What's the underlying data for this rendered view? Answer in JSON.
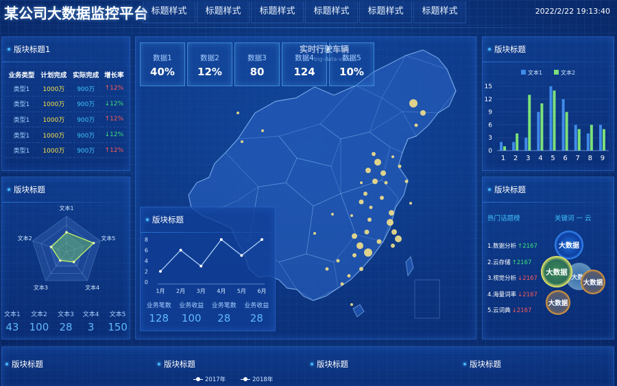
{
  "header": {
    "title": "某公司大数据监控平台",
    "tabs": [
      "标题样式",
      "标题样式",
      "标题样式",
      "标题样式",
      "标题样式",
      "标题样式"
    ],
    "datetime": "2022/2/22 19:13:40"
  },
  "panel_table": {
    "title": "版块标题1",
    "columns": [
      "业务类型",
      "计划完成",
      "实际完成",
      "增长率"
    ],
    "rows": [
      {
        "type": "类型1",
        "plan": "1000万",
        "done": "900万",
        "growth": "↑12%",
        "dir": "up"
      },
      {
        "type": "类型1",
        "plan": "1000万",
        "done": "900万",
        "growth": "↓12%",
        "dir": "down"
      },
      {
        "type": "类型1",
        "plan": "1000万",
        "done": "900万",
        "growth": "↑12%",
        "dir": "up"
      },
      {
        "type": "类型1",
        "plan": "1000万",
        "done": "900万",
        "growth": "↓12%",
        "dir": "down"
      },
      {
        "type": "类型1",
        "plan": "1000万",
        "done": "900万",
        "growth": "↑12%",
        "dir": "up"
      }
    ]
  },
  "panel_radar": {
    "title": "版块标题",
    "axis_labels": [
      "文本1",
      "文本5",
      "文本4",
      "文本3",
      "文本2"
    ],
    "stats": [
      {
        "label": "文本1",
        "value": "43"
      },
      {
        "label": "文本2",
        "value": "100"
      },
      {
        "label": "文本3",
        "value": "28"
      },
      {
        "label": "文本4",
        "value": "3"
      },
      {
        "label": "文本5",
        "value": "150"
      }
    ]
  },
  "kpis": [
    {
      "label": "数据1",
      "value": "40%"
    },
    {
      "label": "数据2",
      "value": "12%"
    },
    {
      "label": "数据3",
      "value": "80"
    },
    {
      "label": "数据4",
      "value": "124"
    },
    {
      "label": "数据5",
      "value": "10%"
    }
  ],
  "map": {
    "title": "实时行驶车辆",
    "subtitle": "big-data-view"
  },
  "panel_line": {
    "title": "版块标题",
    "stats": [
      {
        "label": "业务笔数",
        "value": "128"
      },
      {
        "label": "业务收益",
        "value": "100"
      },
      {
        "label": "业务笔数",
        "value": "28"
      },
      {
        "label": "业务收益",
        "value": "28"
      }
    ]
  },
  "panel_bar": {
    "title": "版块标题"
  },
  "panel_hot": {
    "title": "版块标题",
    "hot_topics_title": "热门话题榜",
    "wordcloud_title": "关键词 一 云",
    "items": [
      {
        "name": "1.数据分析",
        "trend": "↑2167",
        "dir": "up"
      },
      {
        "name": "2.云存储",
        "trend": "↑2167",
        "dir": "up"
      },
      {
        "name": "3.视觉分析",
        "trend": "↓2167",
        "dir": "down"
      },
      {
        "name": "4.海量词率",
        "trend": "↓2167",
        "dir": "down"
      },
      {
        "name": "5.云词典",
        "trend": "↓2167",
        "dir": "down"
      }
    ],
    "bubbles": [
      "大数据",
      "大数据",
      "大数据",
      "大数据",
      "大数据"
    ]
  },
  "bottom_panels": [
    {
      "title": "版块标题"
    },
    {
      "title": "版块标题"
    },
    {
      "title": "版块标题"
    },
    {
      "title": "版块标题"
    }
  ],
  "bottom_legend": [
    "2017年",
    "2018年"
  ],
  "chart_data": [
    {
      "type": "line",
      "categories": [
        "1月",
        "2月",
        "3月",
        "4月",
        "5月",
        "6月"
      ],
      "values": [
        2,
        6,
        3,
        8,
        5,
        8
      ],
      "ylim": [
        0,
        8
      ],
      "yticks": [
        "0",
        "2",
        "4",
        "6",
        "8"
      ]
    },
    {
      "type": "bar",
      "categories": [
        "1",
        "2",
        "3",
        "4",
        "5",
        "6",
        "7",
        "8",
        "9"
      ],
      "series": [
        {
          "name": "文本1",
          "color": "#3f8bea",
          "values": [
            2,
            2,
            3,
            9,
            15,
            12,
            6,
            4,
            6
          ]
        },
        {
          "name": "文本2",
          "color": "#7be07b",
          "values": [
            1,
            4,
            13,
            11,
            14,
            9,
            5,
            6,
            5
          ]
        }
      ],
      "ylim": [
        0,
        15
      ],
      "yticks": [
        "0",
        "3",
        "6",
        "9",
        "12",
        "15"
      ],
      "legend": "top"
    },
    {
      "type": "radar",
      "categories": [
        "文本1",
        "文本5",
        "文本4",
        "文本3",
        "文本2"
      ],
      "values": [
        0.55,
        0.8,
        0.35,
        0.3,
        0.45
      ]
    }
  ]
}
